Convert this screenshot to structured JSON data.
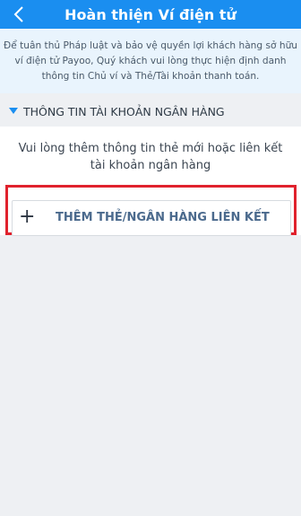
{
  "header": {
    "title": "Hoàn thiện Ví điện tử",
    "back_icon": "chevron-left-icon",
    "background_color": "#1a8ef0"
  },
  "notice": {
    "text": "Để tuân thủ Pháp luật và bảo vệ quyền lợi khách hàng sở hữu ví điện tử Payoo, Quý khách vui lòng thực hiện định danh thông tin Chủ ví và Thẻ/Tài khoản thanh toán."
  },
  "section": {
    "title": "THÔNG TIN TÀI KHOẢN NGÂN HÀNG",
    "icon": "triangle-down-icon"
  },
  "card": {
    "message": "Vui lòng thêm thông tin thẻ mới hoặc liên kết tài khoản ngân hàng",
    "add_button_icon": "plus-icon",
    "add_button_label": "THÊM THẺ/NGÂN HÀNG LIÊN KẾT",
    "highlight_color": "#e0222d"
  }
}
